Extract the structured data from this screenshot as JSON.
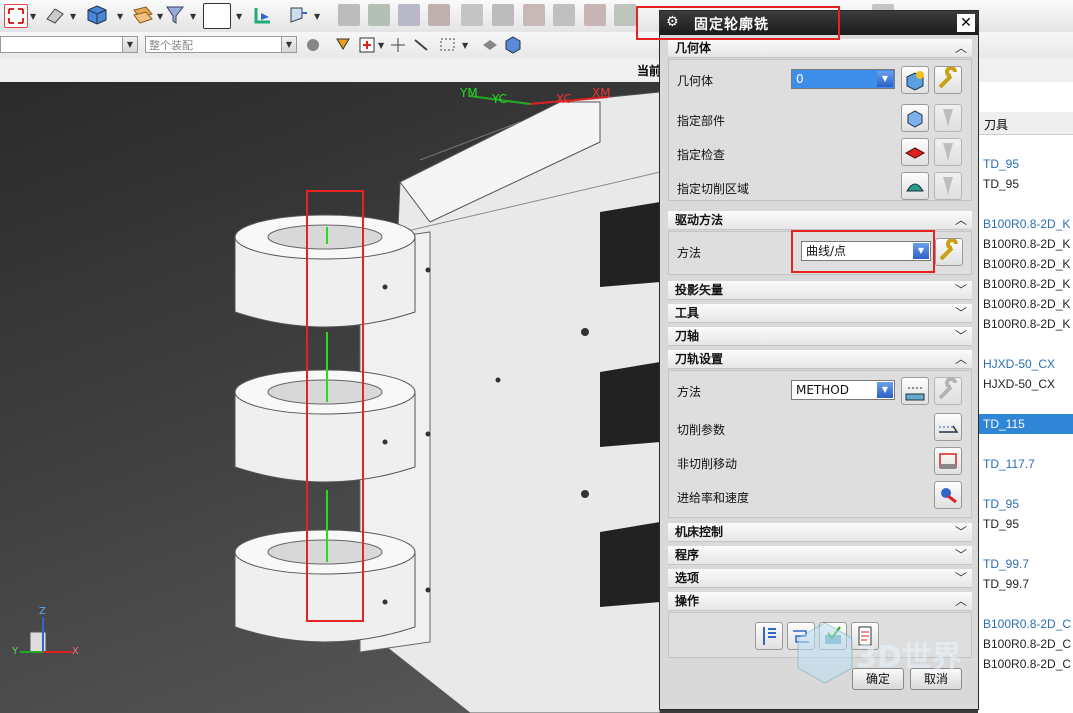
{
  "toolbar": {
    "assembly_filter": "整个装配",
    "current_label": "当前"
  },
  "viewport": {
    "axis_labels": {
      "ym": "YM",
      "yc": "YC",
      "xc": "XC",
      "xm": "XM"
    },
    "triad": {
      "z": "Z",
      "y": "Y",
      "x": "X"
    }
  },
  "dialog": {
    "title": "固定轮廓铣",
    "geometry": {
      "header": "几何体",
      "label": "几何体",
      "value": "0",
      "specify_part": "指定部件",
      "specify_check": "指定检查",
      "specify_cut_area": "指定切削区域"
    },
    "drive": {
      "header": "驱动方法",
      "label": "方法",
      "value": "曲线/点"
    },
    "collapsed": {
      "projection_vector": "投影矢量",
      "tool": "工具",
      "tool_axis": "刀轴"
    },
    "path_settings": {
      "header": "刀轨设置",
      "method_label": "方法",
      "method_value": "METHOD",
      "cut_params": "切削参数",
      "non_cut_moves": "非切削移动",
      "feeds_speeds": "进给率和速度"
    },
    "collapsed2": {
      "machine_control": "机床控制",
      "program": "程序",
      "options": "选项"
    },
    "actions": {
      "header": "操作"
    },
    "ok_label": "确定",
    "cancel_label": "取消"
  },
  "tool_list": {
    "header": "刀具",
    "rows": [
      {
        "text": "TD_95",
        "style": "link"
      },
      {
        "text": "TD_95",
        "style": "plain"
      },
      {
        "text": "",
        "style": "plain"
      },
      {
        "text": "B100R0.8-2D_K",
        "style": "link"
      },
      {
        "text": "B100R0.8-2D_K",
        "style": "plain"
      },
      {
        "text": "B100R0.8-2D_K",
        "style": "plain"
      },
      {
        "text": "B100R0.8-2D_K",
        "style": "plain"
      },
      {
        "text": "B100R0.8-2D_K",
        "style": "plain"
      },
      {
        "text": "B100R0.8-2D_K",
        "style": "plain"
      },
      {
        "text": "",
        "style": "plain"
      },
      {
        "text": "HJXD-50_CX",
        "style": "link"
      },
      {
        "text": "HJXD-50_CX",
        "style": "plain"
      },
      {
        "text": "",
        "style": "plain"
      },
      {
        "text": "TD_115",
        "style": "sel"
      },
      {
        "text": "",
        "style": "plain"
      },
      {
        "text": "TD_117.7",
        "style": "link"
      },
      {
        "text": "",
        "style": "plain"
      },
      {
        "text": "TD_95",
        "style": "link"
      },
      {
        "text": "TD_95",
        "style": "plain"
      },
      {
        "text": "",
        "style": "plain"
      },
      {
        "text": "TD_99.7",
        "style": "link"
      },
      {
        "text": "TD_99.7",
        "style": "plain"
      },
      {
        "text": "",
        "style": "plain"
      },
      {
        "text": "B100R0.8-2D_C",
        "style": "link"
      },
      {
        "text": "B100R0.8-2D_C",
        "style": "plain"
      },
      {
        "text": "B100R0.8-2D_C",
        "style": "plain"
      }
    ]
  },
  "watermark": "3D世界",
  "colors": {
    "accent_red": "#e8221e",
    "selection": "#2f86d6",
    "link": "#2a6eb5"
  }
}
